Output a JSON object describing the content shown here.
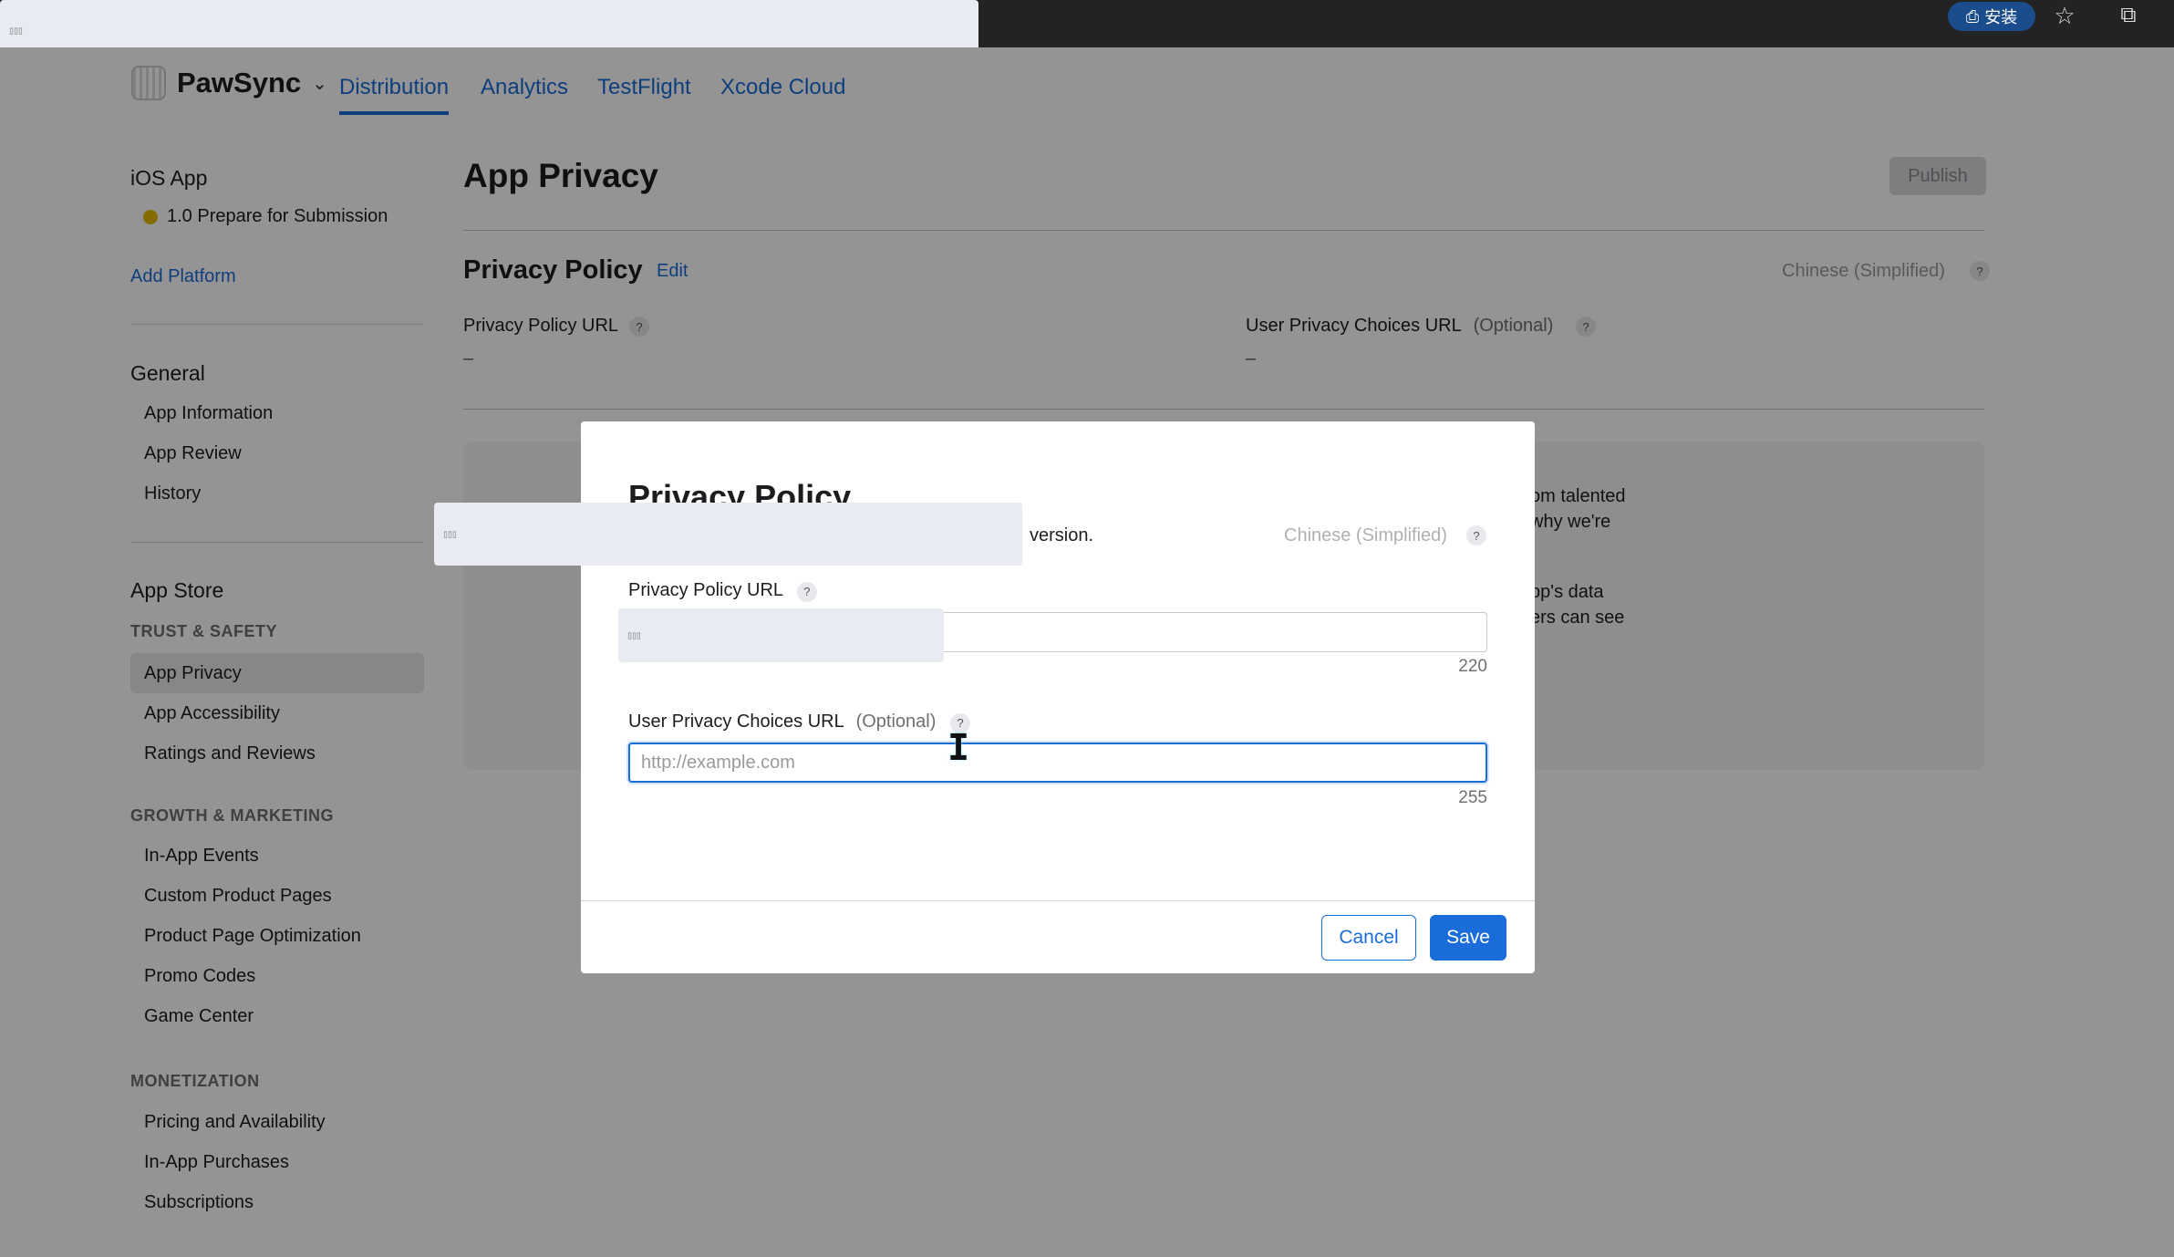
{
  "browser": {
    "install_label": "安装",
    "star_icon": "star-icon",
    "extension_icon": "puzzle-icon",
    "tab_placeholder": "▯▯▯"
  },
  "topnav": {
    "app_name": "PawSync",
    "tabs": [
      {
        "label": "Distribution",
        "active": true
      },
      {
        "label": "Analytics"
      },
      {
        "label": "TestFlight"
      },
      {
        "label": "Xcode Cloud"
      }
    ]
  },
  "sidebar": {
    "platform_title": "iOS App",
    "version_status": "1.0 Prepare for Submission",
    "add_platform": "Add Platform",
    "general_heading": "General",
    "general_items": [
      "App Information",
      "App Review",
      "History"
    ],
    "appstore_heading": "App Store",
    "trust_category": "TRUST & SAFETY",
    "trust_items": [
      "App Privacy",
      "App Accessibility",
      "Ratings and Reviews"
    ],
    "growth_category": "GROWTH & MARKETING",
    "growth_items": [
      "In-App Events",
      "Custom Product Pages",
      "Product Page Optimization",
      "Promo Codes",
      "Game Center"
    ],
    "monetization_category": "MONETIZATION",
    "monetization_items": [
      "Pricing and Availability",
      "In-App Purchases",
      "Subscriptions"
    ]
  },
  "main": {
    "page_title": "App Privacy",
    "publish_label": "Publish",
    "section_title": "Privacy Policy",
    "edit_label": "Edit",
    "language": "Chinese (Simplified)",
    "privacy_url_label": "Privacy Policy URL",
    "privacy_url_value": "–",
    "choices_url_label": "User Privacy Choices URL",
    "optional_label": "(Optional)",
    "choices_url_value": "–",
    "bg_fragments": [
      "om talented",
      "why we're",
      "pp's data",
      "ers can see"
    ]
  },
  "modal": {
    "title": "Privacy Policy",
    "subtitle_fragment": "version.",
    "language": "Chinese (Simplified)",
    "privacy_url_label": "Privacy Policy URL",
    "privacy_url_value": "",
    "privacy_url_counter": "220",
    "choices_url_label": "User Privacy Choices URL",
    "optional_label": "(Optional)",
    "choices_url_placeholder": "http://example.com",
    "choices_url_counter": "255",
    "cancel_label": "Cancel",
    "save_label": "Save",
    "help_glyph": "?"
  },
  "colors": {
    "accent": "#1a6cd8",
    "status_dot": "#e6b800"
  }
}
